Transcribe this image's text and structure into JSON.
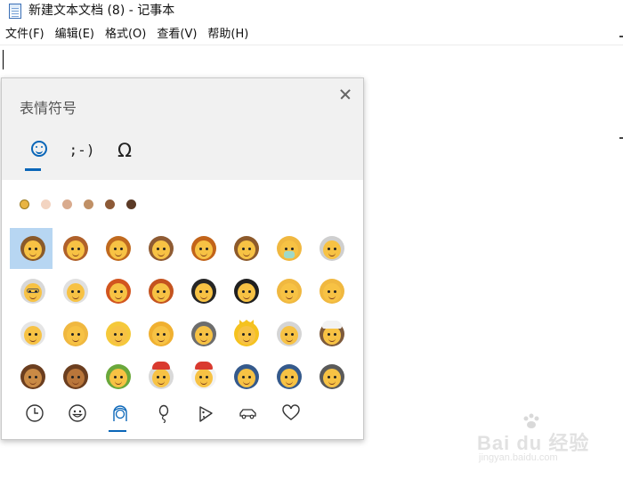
{
  "window": {
    "title": "新建文本文档 (8) - 记事本"
  },
  "menu": [
    {
      "label": "文件(F)",
      "name": "menu-file"
    },
    {
      "label": "编辑(E)",
      "name": "menu-edit"
    },
    {
      "label": "格式(O)",
      "name": "menu-format"
    },
    {
      "label": "查看(V)",
      "name": "menu-view"
    },
    {
      "label": "帮助(H)",
      "name": "menu-help"
    }
  ],
  "emoji_panel": {
    "title": "表情符号",
    "tabs": [
      {
        "name": "tab-emoji",
        "icon": "smiley-icon",
        "label": "",
        "active": true
      },
      {
        "name": "tab-kaomoji",
        "icon": "kaomoji-icon",
        "label": ";-)",
        "active": false
      },
      {
        "name": "tab-symbols",
        "icon": "omega-icon",
        "label": "Ω",
        "active": false
      }
    ],
    "skin_tones": [
      "#e8b443",
      "#f3d4c1",
      "#d9ab8e",
      "#c09066",
      "#8d5a37",
      "#5b3a26"
    ],
    "selected_skin_tone": 0,
    "emoji_grid": [
      [
        {
          "hair": "#8a5a2a",
          "skin": "#f7c244",
          "sel": true
        },
        {
          "hair": "#b0612a",
          "skin": "#f7c244"
        },
        {
          "hair": "#c06a1f",
          "skin": "#f7c244"
        },
        {
          "hair": "#8f5b33",
          "skin": "#f7c244"
        },
        {
          "hair": "#c2641a",
          "skin": "#f7c244"
        },
        {
          "hair": "#8d5a2b",
          "skin": "#f7c244"
        },
        {
          "hair": "#f0b840",
          "skin": "#f7c244",
          "mask": true
        },
        {
          "hair": "#cfcfcf",
          "skin": "#f7c244"
        }
      ],
      [
        {
          "hair": "#d8d8d8",
          "skin": "#f7c244",
          "glasses": true
        },
        {
          "hair": "#e0e0e0",
          "skin": "#f7c244"
        },
        {
          "hair": "#d2551f",
          "skin": "#f7c244"
        },
        {
          "hair": "#c4531f",
          "skin": "#f7c244"
        },
        {
          "hair": "#262626",
          "skin": "#f7c244"
        },
        {
          "hair": "#202020",
          "skin": "#f7c244"
        },
        {
          "hair": "#f0b840",
          "skin": "#f7c244"
        },
        {
          "hair": "#f0b840",
          "skin": "#f7c244"
        }
      ],
      [
        {
          "hair": "#e5e5e5",
          "skin": "#f7c244"
        },
        {
          "hair": "#f0b840",
          "skin": "#f7c244"
        },
        {
          "hair": "#f5c93a",
          "skin": "#f7c244"
        },
        {
          "hair": "#f0b030",
          "skin": "#f7c244"
        },
        {
          "hair": "#6d6d6d",
          "skin": "#f7c244"
        },
        {
          "hair": "#f5c21f",
          "skin": "#f7c244",
          "crown": true
        },
        {
          "hair": "#d5d5d5",
          "skin": "#f7c244"
        },
        {
          "hair": "#7d5a3c",
          "skin": "#f7c244",
          "turban": true
        }
      ],
      [
        {
          "hair": "#6b3e1f",
          "skin": "#c98a45"
        },
        {
          "hair": "#6b3e1f",
          "skin": "#b9763a"
        },
        {
          "hair": "#6aa83b",
          "skin": "#f7c244"
        },
        {
          "hair": "#d9d9d9",
          "skin": "#f7c244",
          "santa": true
        },
        {
          "hair": "#f2f2f2",
          "skin": "#f7c244",
          "santa": true
        },
        {
          "hair": "#355a8c",
          "skin": "#f7c244"
        },
        {
          "hair": "#355a8c",
          "skin": "#f7c244"
        },
        {
          "hair": "#5a5a5a",
          "skin": "#f7c244"
        }
      ]
    ],
    "bottom_tabs": [
      {
        "name": "tab-recent",
        "icon": "clock-icon",
        "active": false
      },
      {
        "name": "tab-smileys",
        "icon": "smiley-icon",
        "active": false
      },
      {
        "name": "tab-people",
        "icon": "person-icon",
        "active": true
      },
      {
        "name": "tab-celebration",
        "icon": "balloon-icon",
        "active": false
      },
      {
        "name": "tab-food",
        "icon": "pizza-icon",
        "active": false
      },
      {
        "name": "tab-travel",
        "icon": "car-icon",
        "active": false
      },
      {
        "name": "tab-symbols-heart",
        "icon": "heart-icon",
        "active": false
      }
    ]
  },
  "watermark": {
    "main": "Bai du 经验",
    "sub": "jingyan.baidu.com"
  }
}
